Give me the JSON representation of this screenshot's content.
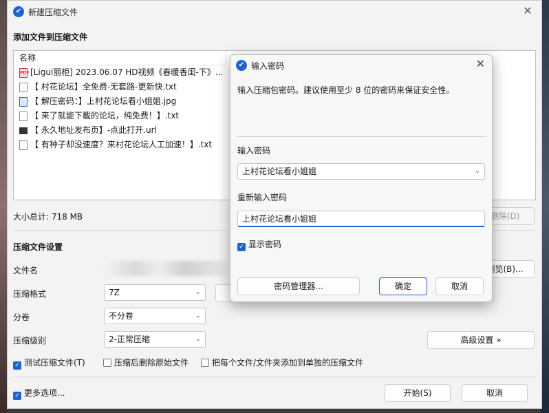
{
  "window": {
    "title": "新建压缩文件",
    "close_icon": "✕"
  },
  "add_section": {
    "heading": "添加文件到压缩文件"
  },
  "filelist": {
    "column_name": "名称",
    "rows": [
      {
        "icon": "pdf",
        "name": "[Ligui丽柜] 2023.06.07 HD视频《春暖香闺-下》..."
      },
      {
        "icon": "doc",
        "name": "【 村花论坛】全免费-无套路-更新快.txt"
      },
      {
        "icon": "img",
        "name": "【 解压密码：】上村花论坛看小姐姐.jpg"
      },
      {
        "icon": "doc",
        "name": "【 来了就能下載的论坛，纯免费！】.txt"
      },
      {
        "icon": "url",
        "name": "【 永久地址发布页】-点此打开.url"
      },
      {
        "icon": "doc",
        "name": "【 有种子却没速度？来村花论坛人工加速！】.txt"
      }
    ]
  },
  "total_size": "大小总计: 718 MB",
  "delete_button": "删除(D)",
  "settings": {
    "heading": "压缩文件设置",
    "filename_label": "文件名",
    "browse_button": "浏览(B)...",
    "format_label": "压缩格式",
    "format_value": "7Z",
    "volume_label": "分卷",
    "volume_value": "不分卷",
    "level_label": "压缩级别",
    "level_value": "2-正常压缩",
    "advanced_button": "高级设置 »",
    "test_check": "测试压缩文件(T)",
    "delete_check": "压缩后删除原始文件",
    "separate_check": "把每个文件/文件夹添加到单独的压缩文件"
  },
  "footer": {
    "more_options": "更多选项...",
    "start_button": "开始(S)",
    "cancel_button": "取消"
  },
  "dialog": {
    "title": "输入密码",
    "description": "输入压缩包密码。建议使用至少 8 位的密码来保证安全性。",
    "password_label": "输入密码",
    "password_value": "上村花论坛看小姐姐",
    "confirm_label": "重新输入密码",
    "confirm_value": "上村花论坛看小姐姐",
    "show_password": "显示密码",
    "manager_button": "密码管理器...",
    "ok_button": "确定",
    "cancel_button": "取消"
  },
  "colors": {
    "accent": "#1e63d0",
    "window_bg": "#f3f3f3"
  }
}
